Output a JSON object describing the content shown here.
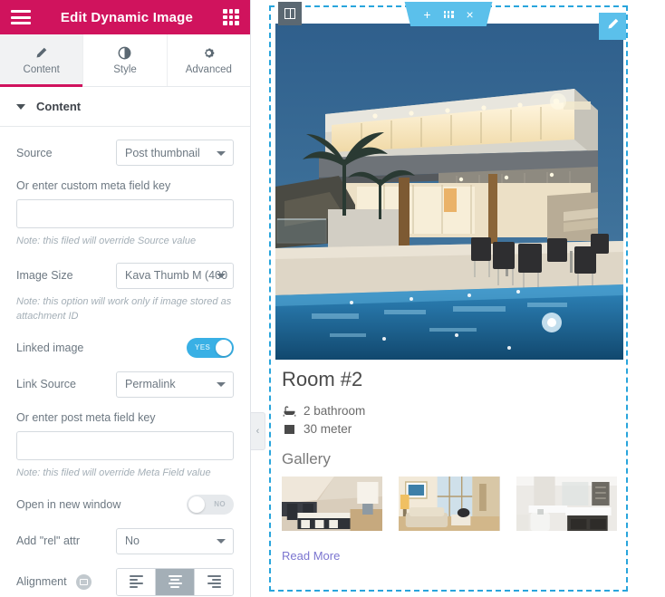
{
  "panel": {
    "header": {
      "title": "Edit Dynamic Image",
      "menu_icon": "hamburger-menu-icon",
      "grid_icon": "widgets-grid-icon",
      "bg_color": "#d0135d"
    },
    "tabs": [
      {
        "label": "Content",
        "icon": "pencil-icon",
        "active": true
      },
      {
        "label": "Style",
        "icon": "contrast-icon",
        "active": false
      },
      {
        "label": "Advanced",
        "icon": "gear-icon",
        "active": false
      }
    ],
    "section": {
      "label": "Content",
      "caret_icon": "chevron-down-icon"
    },
    "controls": {
      "source": {
        "label": "Source",
        "value": "Post thumbnail"
      },
      "custom_meta_key": {
        "label": "Or enter custom meta field key",
        "value": "",
        "placeholder": "",
        "note": "Note: this filed will override Source value"
      },
      "image_size": {
        "label": "Image Size",
        "value": "Kava Thumb M (400",
        "note": "Note: this option will work only if image stored as attachment ID"
      },
      "linked_image": {
        "label": "Linked image",
        "state": "YES",
        "on": true
      },
      "link_source": {
        "label": "Link Source",
        "value": "Permalink"
      },
      "post_meta_key": {
        "label": "Or enter post meta field key",
        "value": "",
        "placeholder": "",
        "note": "Note: this filed will override Meta Field value"
      },
      "open_new_window": {
        "label": "Open in new window",
        "state": "NO",
        "on": false
      },
      "rel_attr": {
        "label": "Add \"rel\" attr",
        "value": "No"
      },
      "alignment": {
        "label": "Alignment",
        "device_icon": "desktop-device-icon",
        "options": [
          "left",
          "center",
          "right"
        ],
        "selected": "center"
      }
    },
    "collapse_handle": {
      "icon": "chevron-left-icon",
      "glyph": "‹"
    }
  },
  "preview": {
    "section_handle_icon": "columns-handle-icon",
    "section_tools": [
      {
        "name": "add-section-button",
        "glyph": "+"
      },
      {
        "name": "edit-section-button",
        "glyph": "dots"
      },
      {
        "name": "delete-section-button",
        "glyph": "×"
      }
    ],
    "edit_widget_button": {
      "icon": "pencil-edit-icon"
    },
    "hero_image": {
      "alt": "modern-house-with-pool-at-dusk"
    },
    "post": {
      "title": "Room #2",
      "meta": [
        {
          "icon": "bathtub-icon",
          "text": "2 bathroom"
        },
        {
          "icon": "square-area-icon",
          "text": "30 meter"
        }
      ],
      "gallery_title": "Gallery",
      "gallery": [
        {
          "alt": "bedroom-thumbnail"
        },
        {
          "alt": "living-room-thumbnail"
        },
        {
          "alt": "bathroom-thumbnail"
        }
      ],
      "read_more": "Read More",
      "link_color": "#7b75d0"
    }
  }
}
